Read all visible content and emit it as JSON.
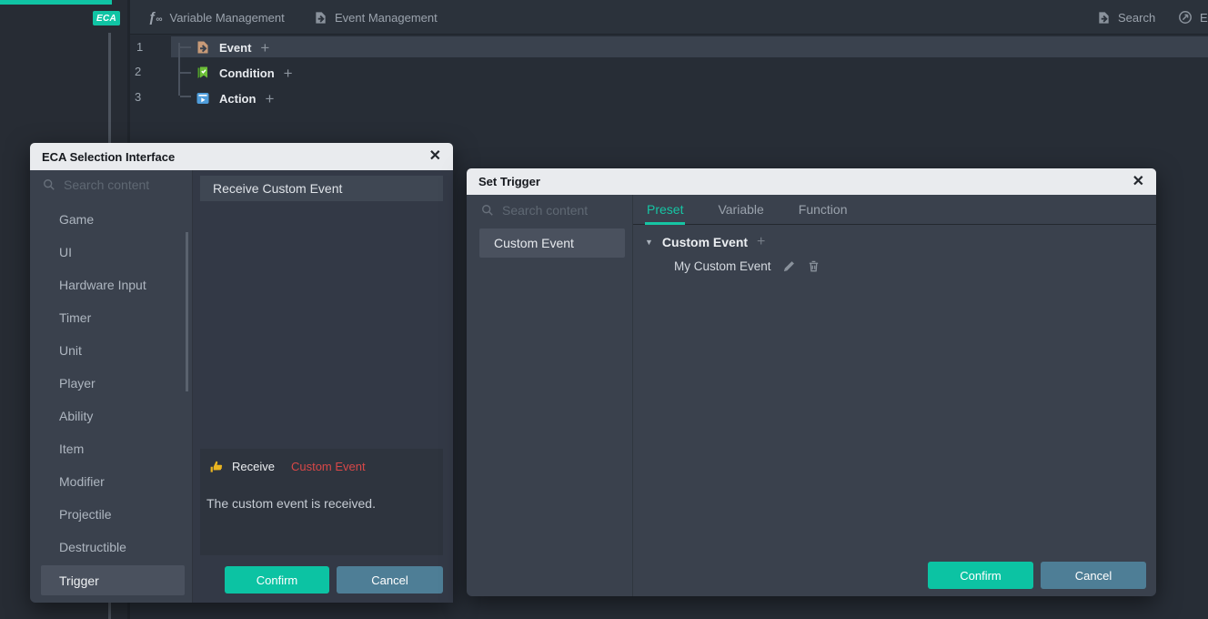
{
  "colors": {
    "accent_teal": "#10c4a4",
    "confirm_button": "#0cc3a3",
    "cancel_button": "#4e7e96",
    "param_red": "#d84848",
    "title_bar": "#e9ebee"
  },
  "icons": {
    "plus": "+",
    "close": "✕",
    "caret_down": "▼",
    "fx": "ƒ"
  },
  "sidebar": {
    "badge": "ECA"
  },
  "topbar": {
    "variable_management": "Variable Management",
    "event_management": "Event Management",
    "search": "Search",
    "truncated_item": "E"
  },
  "editor": {
    "line_numbers": [
      "1",
      "2",
      "3"
    ],
    "rows": [
      {
        "label": "Event"
      },
      {
        "label": "Condition"
      },
      {
        "label": "Action"
      }
    ]
  },
  "eca_dialog": {
    "title": "ECA Selection Interface",
    "search_placeholder": "Search content",
    "categories": [
      "Game",
      "UI",
      "Hardware Input",
      "Timer",
      "Unit",
      "Player",
      "Ability",
      "Item",
      "Modifier",
      "Projectile",
      "Destructible",
      "Trigger"
    ],
    "selected_category": "Trigger",
    "result_item": "Receive Custom Event",
    "detail": {
      "keyword": "Receive",
      "param": "Custom Event",
      "description": "The custom event is received."
    },
    "confirm_label": "Confirm",
    "cancel_label": "Cancel"
  },
  "set_trigger_dialog": {
    "title": "Set Trigger",
    "search_placeholder": "Search content",
    "selected_item": "Custom Event",
    "tabs": [
      "Preset",
      "Variable",
      "Function"
    ],
    "active_tab": "Preset",
    "tree_group": "Custom Event",
    "tree_child": "My Custom Event",
    "confirm_label": "Confirm",
    "cancel_label": "Cancel"
  }
}
